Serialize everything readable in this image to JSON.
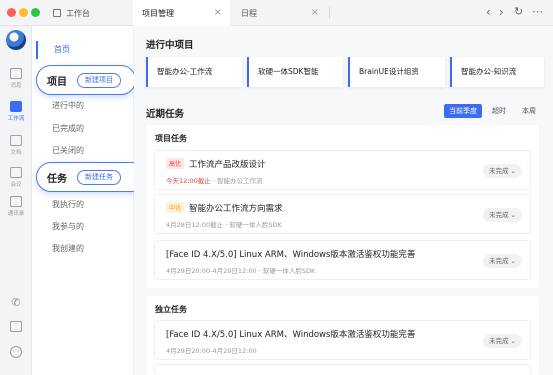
{
  "titlebar": {
    "tabs": [
      {
        "label": "工作台"
      },
      {
        "label": "项目管理"
      },
      {
        "label": "日程"
      }
    ],
    "traffic_colors": [
      "#ff5f57",
      "#febc2e",
      "#28c840"
    ]
  },
  "rail": {
    "items": [
      {
        "label": "消息",
        "icon": "chat-icon"
      },
      {
        "label": "工作流",
        "icon": "workflow-icon"
      },
      {
        "label": "文档",
        "icon": "document-icon"
      },
      {
        "label": "会议",
        "icon": "video-icon"
      },
      {
        "label": "通讯录",
        "icon": "contacts-icon"
      }
    ],
    "bottom_icons": [
      "phone-icon",
      "box-icon",
      "more-icon"
    ]
  },
  "sidebar": {
    "home": "首页",
    "project_section": {
      "title": "项目",
      "button": "新建项目"
    },
    "project_items": [
      "进行中的",
      "已完成的",
      "已关闭的"
    ],
    "task_section": {
      "title": "任务",
      "button": "新建任务"
    },
    "task_items": [
      "我执行的",
      "我参与的",
      "我创建的"
    ]
  },
  "main": {
    "ongoing_title": "进行中项目",
    "projects": [
      "智能办公-工作流",
      "软硬一体SDK智能",
      "BrainUE设计组资",
      "智能办公-知识流"
    ],
    "recent_title": "近期任务",
    "filters": [
      "当前季度",
      "超时",
      "本周"
    ],
    "project_tasks_title": "项目任务",
    "project_tasks": [
      {
        "badge": "高优",
        "title": "工作流产品改版设计",
        "due": "今天12:00截止",
        "meta": "· 智能办公工作流",
        "status": "未完成"
      },
      {
        "badge": "中优",
        "title": "智能办公工作流方向需求",
        "due": "",
        "meta": "4月28日12:00截止 · 软硬一体人脸SDK",
        "status": "未完成"
      },
      {
        "badge": "",
        "title": "[Face ID 4.X/5.0] Linux ARM、Windows版本激活鉴权功能完善",
        "due": "",
        "meta": "4月29日20:00-4月29日12:00 · 软硬一体人脸SDK",
        "status": "未完成"
      }
    ],
    "independent_title": "独立任务",
    "independent_tasks": [
      {
        "title": "[Face ID 4.X/5.0] Linux ARM、Windows版本激活鉴权功能完善",
        "meta": "4月29日20:00-4月29日12:00",
        "status": "未完成"
      }
    ]
  }
}
